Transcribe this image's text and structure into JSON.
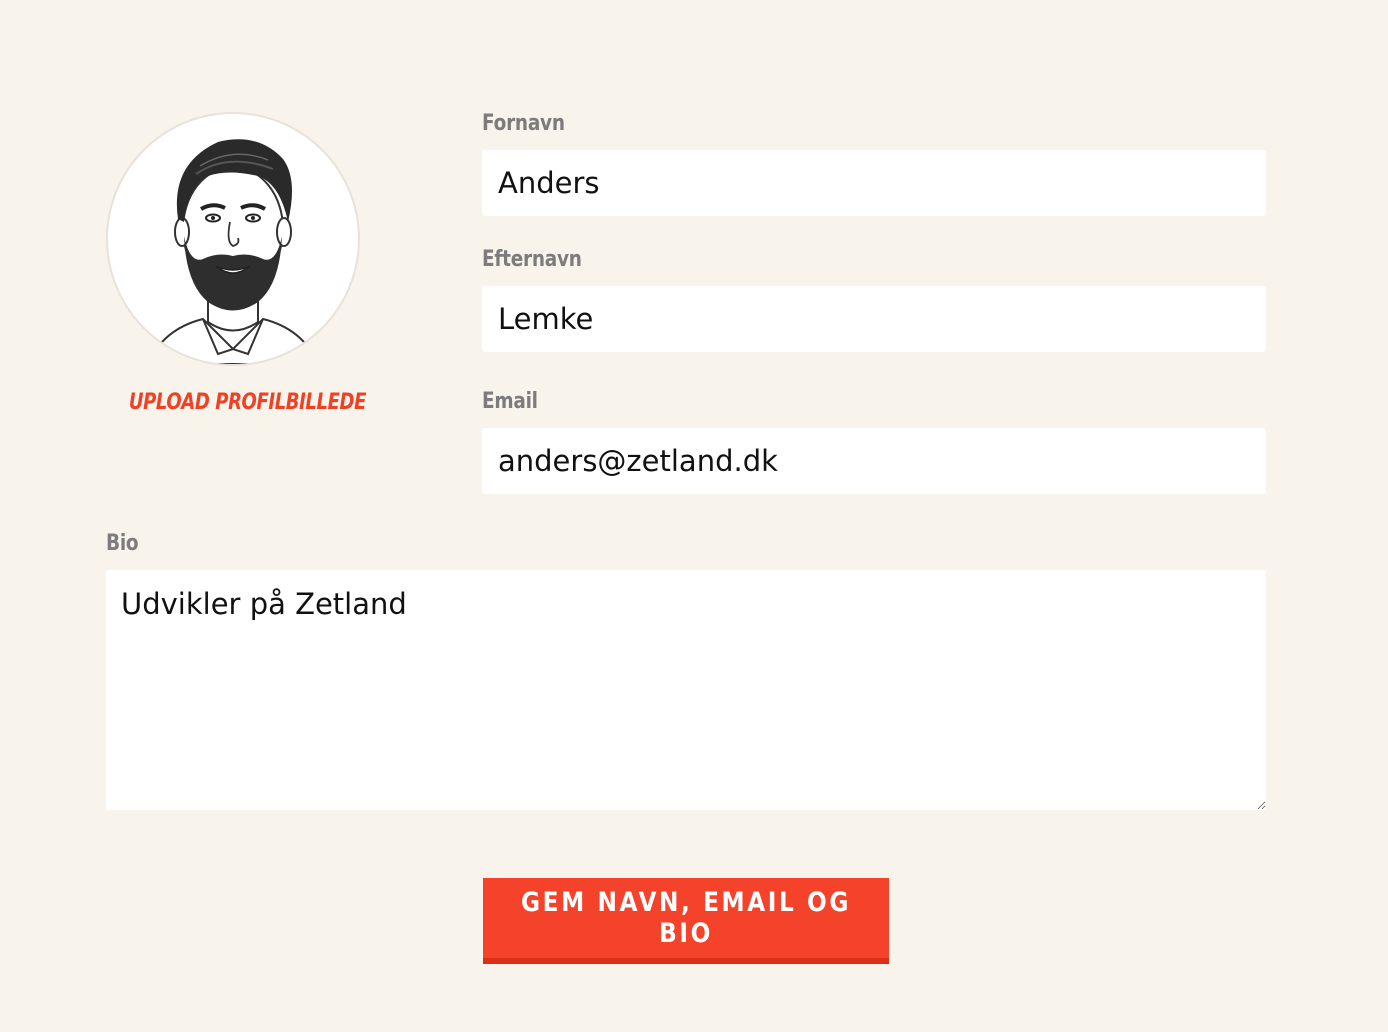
{
  "profile": {
    "upload_label": "UPLOAD PROFILBILLEDE"
  },
  "form": {
    "first_name": {
      "label": "Fornavn",
      "value": "Anders"
    },
    "last_name": {
      "label": "Efternavn",
      "value": "Lemke"
    },
    "email": {
      "label": "Email",
      "value": "anders@zetland.dk"
    },
    "bio": {
      "label": "Bio",
      "value": "Udvikler på Zetland"
    }
  },
  "actions": {
    "save_label": "GEM NAVN, EMAIL OG BIO"
  },
  "colors": {
    "background": "#f8f3eb",
    "accent": "#f5422a",
    "label": "#7d7b7c"
  },
  "icons": [
    "avatar-illustration",
    "resize-handle-icon"
  ]
}
